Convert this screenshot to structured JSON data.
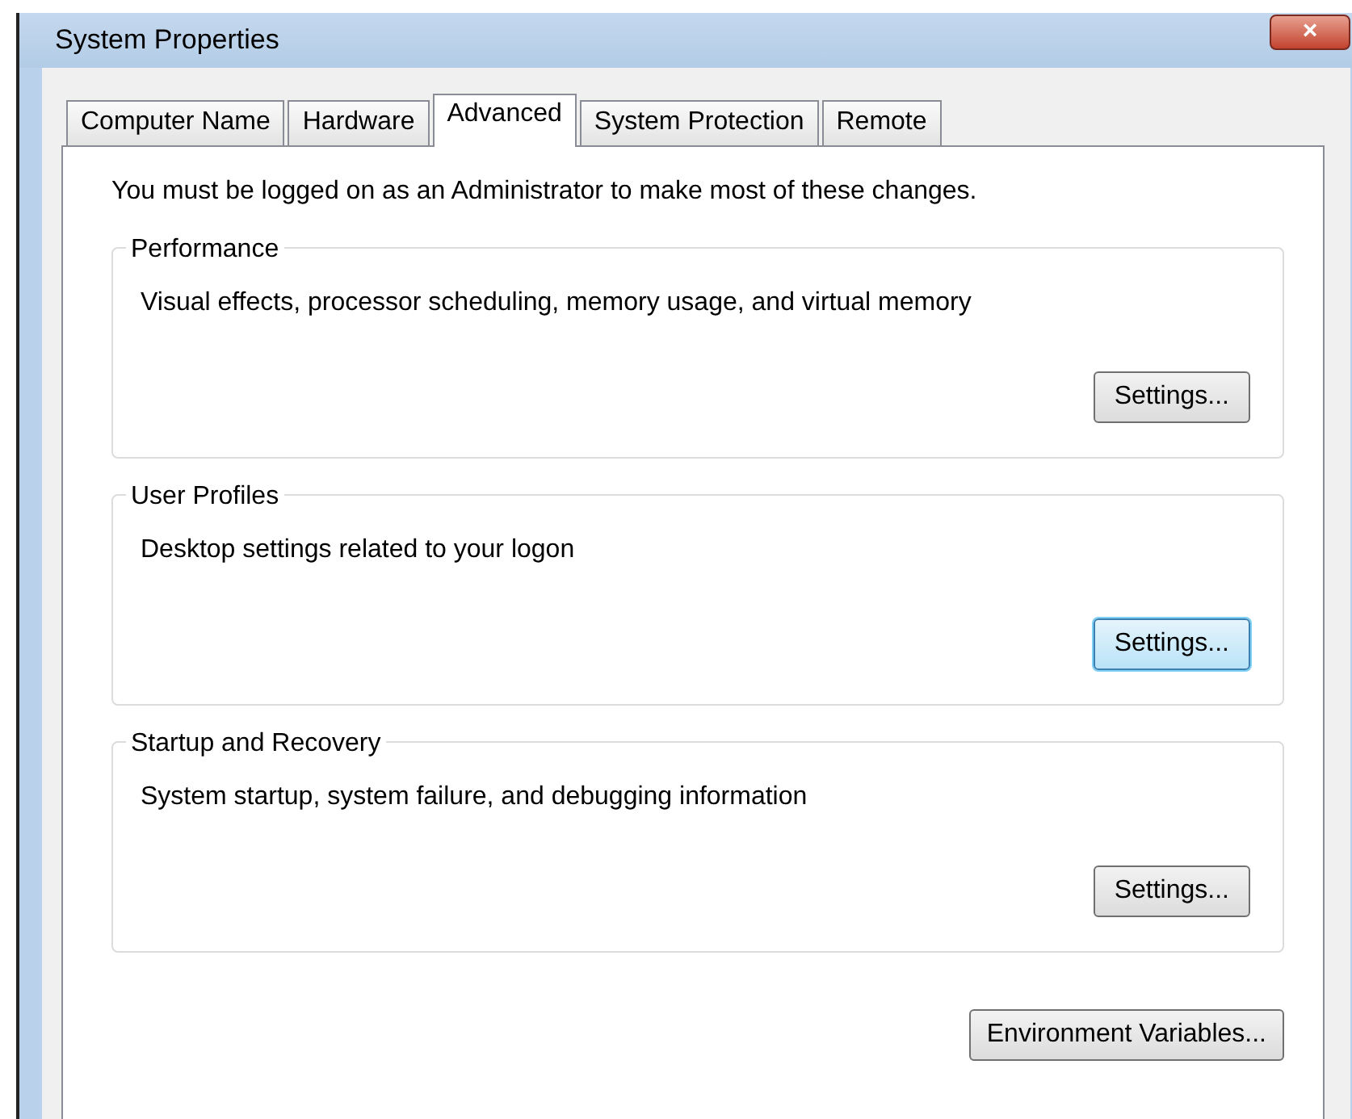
{
  "window": {
    "title": "System Properties",
    "close": "×"
  },
  "tabs": [
    {
      "label": "Computer Name",
      "selected": false
    },
    {
      "label": "Hardware",
      "selected": false
    },
    {
      "label": "Advanced",
      "selected": true
    },
    {
      "label": "System Protection",
      "selected": false
    },
    {
      "label": "Remote",
      "selected": false
    }
  ],
  "notice": "You must be logged on as an Administrator to make most of these changes.",
  "groups": [
    {
      "title": "Performance",
      "description": "Visual effects, processor scheduling, memory usage, and virtual memory",
      "button": {
        "label": "Settings...",
        "focused": false
      }
    },
    {
      "title": "User Profiles",
      "description": "Desktop settings related to your logon",
      "button": {
        "label": "Settings...",
        "focused": true
      }
    },
    {
      "title": "Startup and Recovery",
      "description": "System startup, system failure, and debugging information",
      "button": {
        "label": "Settings...",
        "focused": false
      }
    }
  ],
  "footer_button": {
    "label": "Environment Variables...",
    "focused": false
  }
}
